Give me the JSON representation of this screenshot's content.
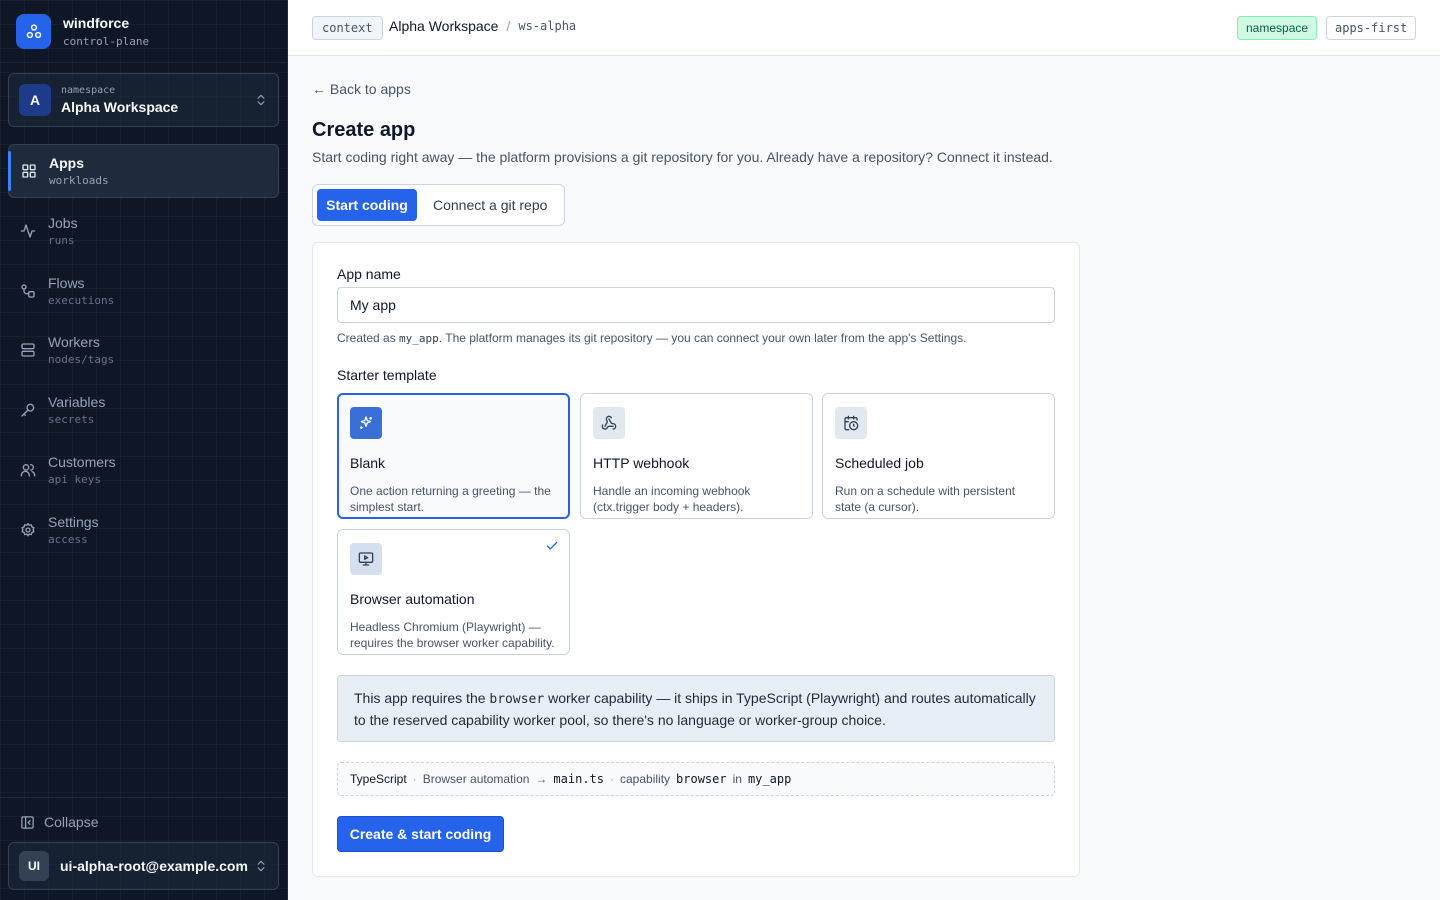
{
  "brand": {
    "name": "windforce",
    "subtitle": "control-plane"
  },
  "namespace_switcher": {
    "avatar": "A",
    "label": "namespace",
    "value": "Alpha Workspace"
  },
  "nav": [
    {
      "label": "Apps",
      "sub": "workloads",
      "icon": "grid-icon",
      "active": true
    },
    {
      "label": "Jobs",
      "sub": "runs",
      "icon": "activity-icon",
      "active": false
    },
    {
      "label": "Flows",
      "sub": "executions",
      "icon": "flow-icon",
      "active": false
    },
    {
      "label": "Workers",
      "sub": "nodes/tags",
      "icon": "server-icon",
      "active": false
    },
    {
      "label": "Variables",
      "sub": "secrets",
      "icon": "key-icon",
      "active": false
    },
    {
      "label": "Customers",
      "sub": "api keys",
      "icon": "users-icon",
      "active": false
    },
    {
      "label": "Settings",
      "sub": "access",
      "icon": "gear-icon",
      "active": false
    }
  ],
  "sidebar_footer": {
    "collapse_label": "Collapse",
    "user_avatar": "UI",
    "user_email": "ui-alpha-root@example.com"
  },
  "topbar": {
    "context_badge": "context",
    "workspace": "Alpha Workspace",
    "separator": "/",
    "workspace_id": "ws-alpha",
    "tag_namespace": "namespace",
    "tag_apps_first": "apps-first"
  },
  "page": {
    "back_link": "← Back to apps",
    "title": "Create app",
    "subtitle": "Start coding right away — the platform provisions a git repository for you. Already have a repository? Connect it instead.",
    "tabs": [
      {
        "label": "Start coding",
        "active": true
      },
      {
        "label": "Connect a git repo",
        "active": false
      }
    ]
  },
  "form": {
    "app_name_label": "App name",
    "app_name_value": "My app",
    "help_prefix": "Created as ",
    "help_slug": "my_app",
    "help_suffix": ". The platform manages its git repository — you can connect your own later from the app's Settings.",
    "starter_label": "Starter template",
    "templates": [
      {
        "title": "Blank",
        "desc": "One action returning a greeting — the simplest start.",
        "icon": "sparkles-icon"
      },
      {
        "title": "HTTP webhook",
        "desc": "Handle an incoming webhook (ctx.trigger body + headers).",
        "icon": "webhook-icon"
      },
      {
        "title": "Scheduled job",
        "desc": "Run on a schedule with persistent state (a cursor).",
        "icon": "calendar-clock-icon"
      },
      {
        "title": "Browser automation",
        "desc": "Headless Chromium (Playwright) — requires the browser worker capability.",
        "icon": "monitor-play-icon"
      }
    ],
    "notice": {
      "before": "This app requires the ",
      "code": "browser",
      "after": " worker capability — it ships in TypeScript (Playwright) and routes automatically to the reserved capability worker pool, so there's no language or worker-group choice."
    },
    "summary": {
      "language": "TypeScript",
      "dot": "·",
      "template": "Browser automation",
      "arrow": "→",
      "file": "main.ts",
      "capability_word": "capability",
      "capability": "browser",
      "in_word": "in",
      "slug": "my_app"
    },
    "create_button": "Create & start coding"
  },
  "colors": {
    "accent": "#2563eb",
    "sidebar_bg": "#0f1726",
    "success_tag_bg": "#d1fae5"
  }
}
